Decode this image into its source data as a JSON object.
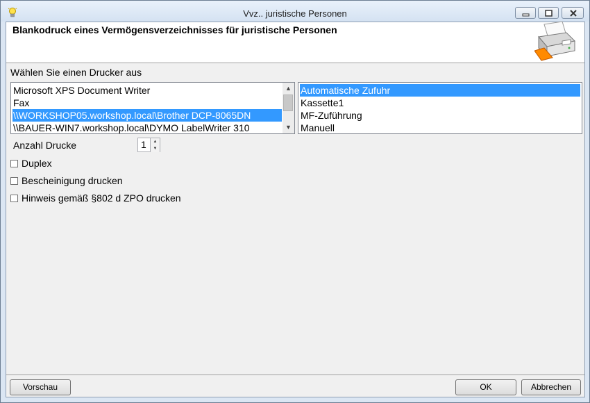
{
  "window": {
    "title": "Vvz.. juristische Personen",
    "minimize_icon": "minimize-icon",
    "maximize_icon": "maximize-icon",
    "close_icon": "close-icon",
    "app_icon": "lightbulb-icon"
  },
  "header": {
    "title": "Blankodruck eines Vermögensverzeichnisses für juristische Personen",
    "icon": "printer-icon"
  },
  "printer": {
    "label": "Wählen Sie einen Drucker aus",
    "items": [
      "Microsoft XPS Document Writer",
      "Fax",
      "\\\\WORKSHOP05.workshop.local\\Brother DCP-8065DN",
      "\\\\BAUER-WIN7.workshop.local\\DYMO LabelWriter 310"
    ],
    "selected": 2
  },
  "tray": {
    "items": [
      "Automatische Zufuhr",
      "Kassette1",
      "MF-Zuführung",
      "Manuell"
    ],
    "selected": 0
  },
  "copies": {
    "label": "Anzahl Drucke",
    "value": "1"
  },
  "options": {
    "duplex": {
      "label": "Duplex",
      "checked": false
    },
    "certificate": {
      "label": "Bescheinigung drucken",
      "checked": false
    },
    "notice": {
      "label": "Hinweis gemäß §802 d ZPO drucken",
      "checked": false
    }
  },
  "buttons": {
    "preview": "Vorschau",
    "ok": "OK",
    "cancel": "Abbrechen"
  },
  "colors": {
    "selection": "#3399ff",
    "titlebar": "#dbe6f3"
  }
}
